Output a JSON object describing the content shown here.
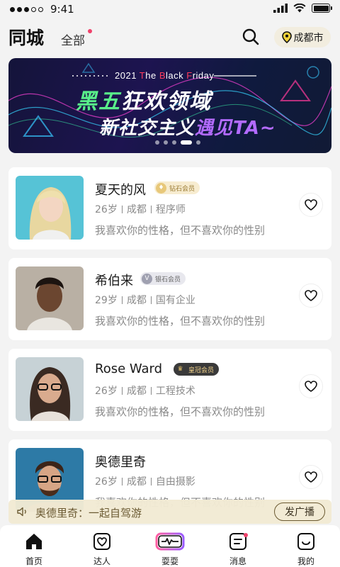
{
  "status_bar": {
    "time": "9:41"
  },
  "header": {
    "title": "同城",
    "tab_all": "全部",
    "city": "成都市"
  },
  "banner": {
    "subtitle_parts": [
      "2021 ",
      "T",
      "he ",
      "B",
      "lack ",
      "F",
      "riday"
    ],
    "line1_highlight": "黑五",
    "line1_rest": "狂欢领域",
    "line2_rest": "新社交主义",
    "line2_highlight": "遇见TA~"
  },
  "users": [
    {
      "name": "夏天的风",
      "badge": "钻石会员",
      "age": "26岁",
      "city": "成都",
      "job": "程序师",
      "bio": "我喜欢你的性格，但不喜欢你的性别"
    },
    {
      "name": "希伯来",
      "badge": "银石会员",
      "badge_icon": "V",
      "age": "29岁",
      "city": "成都",
      "job": "国有企业",
      "bio": "我喜欢你的性格，但不喜欢你的性别"
    },
    {
      "name": "Rose Ward",
      "badge": "皇冠会员",
      "age": "26岁",
      "city": "成都",
      "job": "工程技术",
      "bio": "我喜欢你的性格，但不喜欢你的性别"
    },
    {
      "name": "奥德里奇",
      "age": "26岁",
      "city": "成都",
      "job": "自由摄影",
      "bio": "我喜欢你的性格，但不喜欢你的性别"
    }
  ],
  "broadcast": {
    "text": "奥德里奇：一起自驾游",
    "button": "发广播"
  },
  "tabbar": {
    "items": [
      {
        "label": "首页",
        "icon": "home-icon"
      },
      {
        "label": "达人",
        "icon": "heart-square-icon"
      },
      {
        "label": "耍耍",
        "icon": "pulse-icon"
      },
      {
        "label": "消息",
        "icon": "message-icon"
      },
      {
        "label": "我的",
        "icon": "smile-icon"
      }
    ]
  },
  "colors": {
    "accent": "#f0426b",
    "city_pill": "#f2eddf",
    "broadcast_bg": "#f2ead4",
    "highlight_green": "#59f08a",
    "highlight_purple": "#b36bff"
  }
}
